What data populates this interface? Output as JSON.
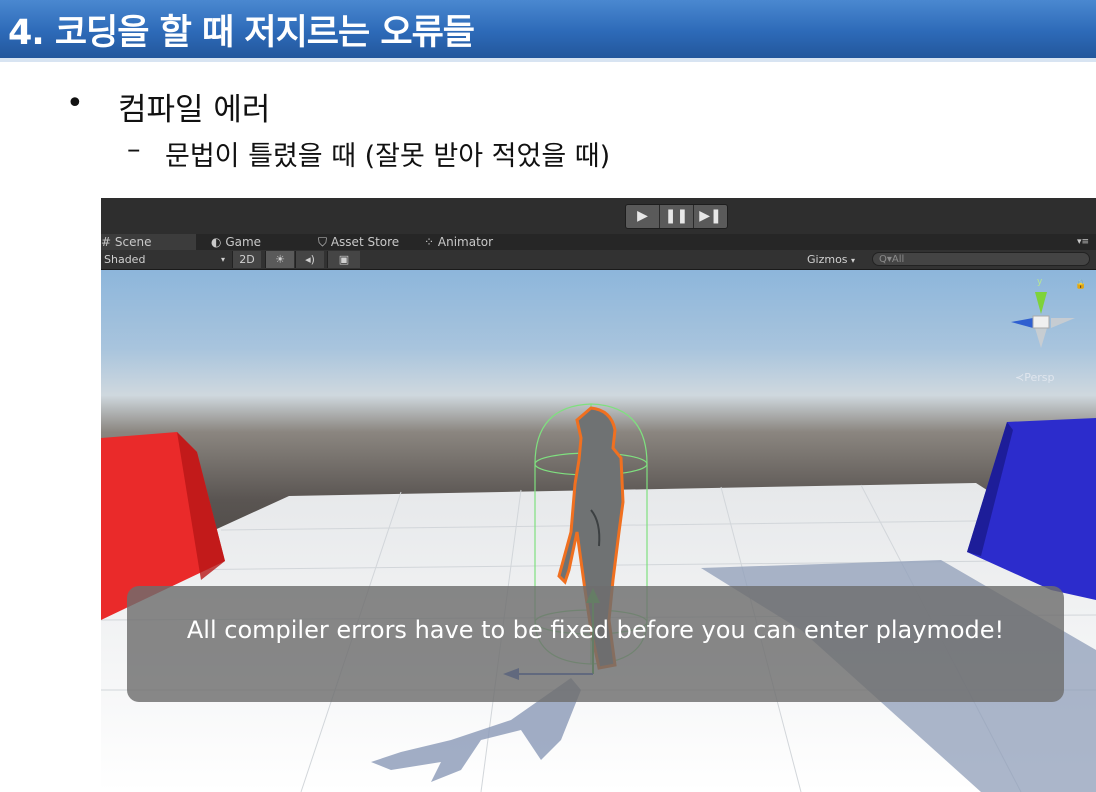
{
  "slide": {
    "title": "4. 코딩을 할 때 저지르는 오류들",
    "bullet": "•",
    "bullet_text": "컴파일 에러",
    "dash": "–",
    "sub_bullet_text": "문법이 틀렸을 때 (잘못 받아 적었을 때)"
  },
  "unity": {
    "play_controls": [
      "▶",
      "❚❚",
      "▶❚"
    ],
    "tabs": [
      {
        "icon": "#",
        "label": "Scene"
      },
      {
        "icon": "◐",
        "label": "Game"
      },
      {
        "icon": "⛉",
        "label": "Asset Store"
      },
      {
        "icon": "⁘",
        "label": "Animator"
      }
    ],
    "toolbar": {
      "shading_mode": "Shaded",
      "mode_2d": "2D",
      "light_icon": "☀",
      "audio_icon": "◂)",
      "effects_icon": "▣",
      "gizmos": "Gizmos",
      "search_placeholder": "Q▾All"
    },
    "gizmo": {
      "axis_label": "y",
      "projection": "≺Persp"
    },
    "error_message": "All compiler errors have to be fixed before you can enter playmode!",
    "colors": {
      "left_cube": "#e8262a",
      "right_cube": "#2424b8",
      "collider": "#7fe07f",
      "selection_outline": "#f07020"
    }
  }
}
